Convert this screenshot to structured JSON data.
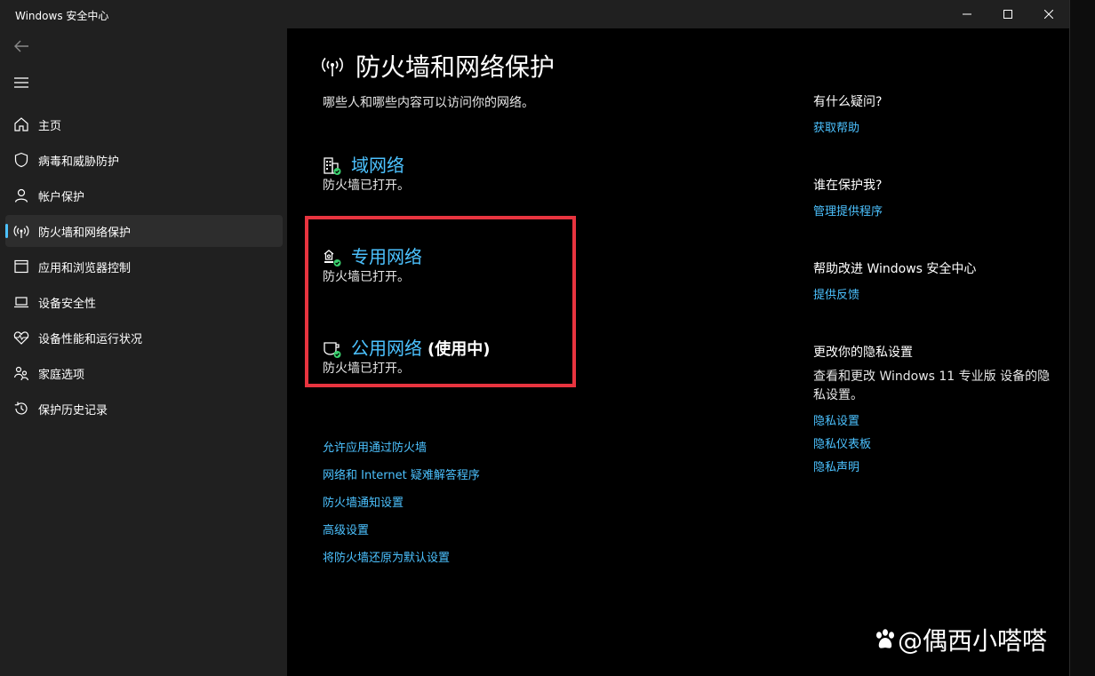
{
  "window": {
    "title": "Windows 安全中心"
  },
  "sidebar": {
    "items": [
      {
        "label": "主页",
        "icon": "home-icon"
      },
      {
        "label": "病毒和威胁防护",
        "icon": "shield-icon"
      },
      {
        "label": "帐户保护",
        "icon": "person-icon"
      },
      {
        "label": "防火墙和网络保护",
        "icon": "antenna-icon",
        "active": true
      },
      {
        "label": "应用和浏览器控制",
        "icon": "app-window-icon"
      },
      {
        "label": "设备安全性",
        "icon": "laptop-icon"
      },
      {
        "label": "设备性能和运行状况",
        "icon": "heart-pulse-icon"
      },
      {
        "label": "家庭选项",
        "icon": "family-icon"
      },
      {
        "label": "保护历史记录",
        "icon": "history-icon"
      }
    ]
  },
  "main": {
    "title": "防火墙和网络保护",
    "subtitle": "哪些人和哪些内容可以访问你的网络。",
    "networks": [
      {
        "name": "域网络",
        "status": "防火墙已打开。",
        "icon": "domain-network-icon"
      },
      {
        "name": "专用网络",
        "status": "防火墙已打开。",
        "icon": "private-network-icon"
      },
      {
        "name": "公用网络",
        "active_label": "(使用中)",
        "status": "防火墙已打开。",
        "icon": "public-network-icon"
      }
    ],
    "links": [
      "允许应用通过防火墙",
      "网络和 Internet 疑难解答程序",
      "防火墙通知设置",
      "高级设置",
      "将防火墙还原为默认设置"
    ]
  },
  "aside": {
    "help_heading": "有什么疑问?",
    "help_link": "获取帮助",
    "protect_heading": "谁在保护我?",
    "protect_link": "管理提供程序",
    "improve_heading": "帮助改进 Windows 安全中心",
    "improve_link": "提供反馈",
    "privacy_heading": "更改你的隐私设置",
    "privacy_text": "查看和更改 Windows 11 专业版 设备的隐私设置。",
    "privacy_links": [
      "隐私设置",
      "隐私仪表板",
      "隐私声明"
    ]
  },
  "watermark": {
    "text": "@偶西小嗒嗒"
  },
  "colors": {
    "accent": "#4cc2ff",
    "highlight": "#e8343f",
    "status_ok": "#3ad16e"
  }
}
